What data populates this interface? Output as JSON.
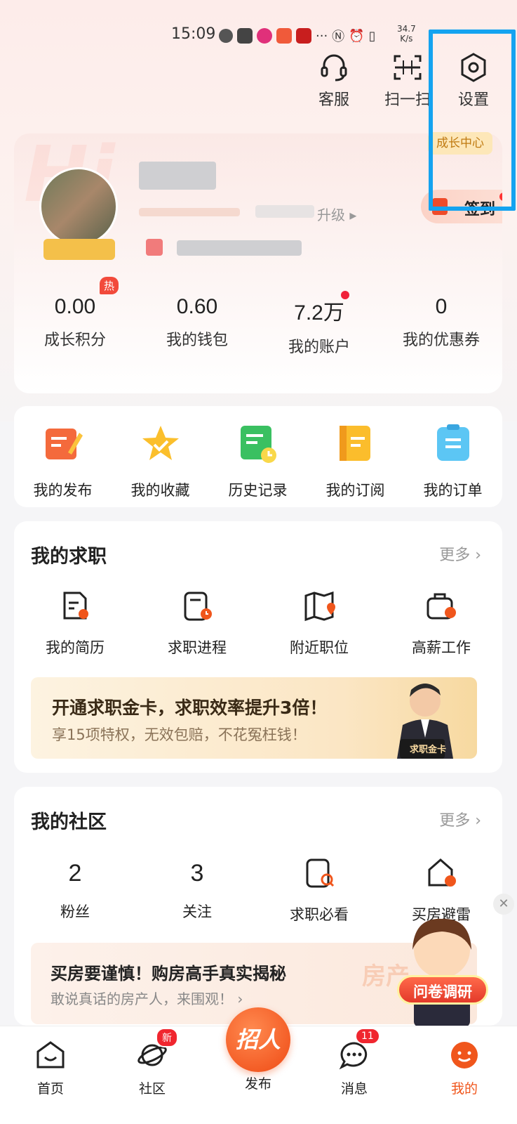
{
  "status_bar": {
    "time": "15:09",
    "more": "···",
    "speed_value": "34.7",
    "speed_unit": "K/s"
  },
  "header": {
    "service_label": "客服",
    "scan_label": "扫一扫",
    "settings_label": "设置"
  },
  "profile": {
    "upgrade_text": "升级 ▸",
    "grow_center": "成长中心",
    "checkin_label": "签到",
    "hot_badge": "热",
    "stats": [
      {
        "value": "0.00",
        "label": "成长积分"
      },
      {
        "value": "0.60",
        "label": "我的钱包"
      },
      {
        "value": "7.2万",
        "label": "我的账户"
      },
      {
        "value": "0",
        "label": "我的优惠券"
      }
    ]
  },
  "quick": [
    {
      "label": "我的发布",
      "icon": "publish-icon"
    },
    {
      "label": "我的收藏",
      "icon": "favorite-star-icon"
    },
    {
      "label": "历史记录",
      "icon": "history-icon"
    },
    {
      "label": "我的订阅",
      "icon": "subscribe-icon"
    },
    {
      "label": "我的订单",
      "icon": "order-icon"
    }
  ],
  "job": {
    "title": "我的求职",
    "more": "更多 ›",
    "items": [
      {
        "label": "我的简历",
        "icon": "resume-icon"
      },
      {
        "label": "求职进程",
        "icon": "progress-icon"
      },
      {
        "label": "附近职位",
        "icon": "nearby-map-icon"
      },
      {
        "label": "高薪工作",
        "icon": "high-salary-icon"
      }
    ],
    "banner_title": "开通求职金卡，求职效率提升3倍！",
    "banner_sub": "享15项特权，无效包赔，不花冤枉钱！",
    "card_label": "求职金卡"
  },
  "community": {
    "title": "我的社区",
    "more": "更多 ›",
    "items": [
      {
        "value": "2",
        "label": "粉丝"
      },
      {
        "value": "3",
        "label": "关注"
      },
      {
        "label": "求职必看",
        "icon": "job-guide-icon"
      },
      {
        "label": "买房避雷",
        "icon": "house-warning-icon"
      }
    ],
    "banner_title": "买房要谨慎！购房高手真实揭秘",
    "banner_sub": "敢说真话的房产人，来围观！ ›",
    "banner_wm": "房产"
  },
  "survey": {
    "label": "问卷调研",
    "close": "✕"
  },
  "tabbar": {
    "home": "首页",
    "community": "社区",
    "community_badge": "新",
    "publish_btn": "招人",
    "publish": "发布",
    "messages": "消息",
    "messages_badge": "11",
    "mine": "我的"
  },
  "colors": {
    "accent": "#f0561c",
    "highlight_box": "#14a3f0",
    "badge_red": "#f0262f"
  }
}
